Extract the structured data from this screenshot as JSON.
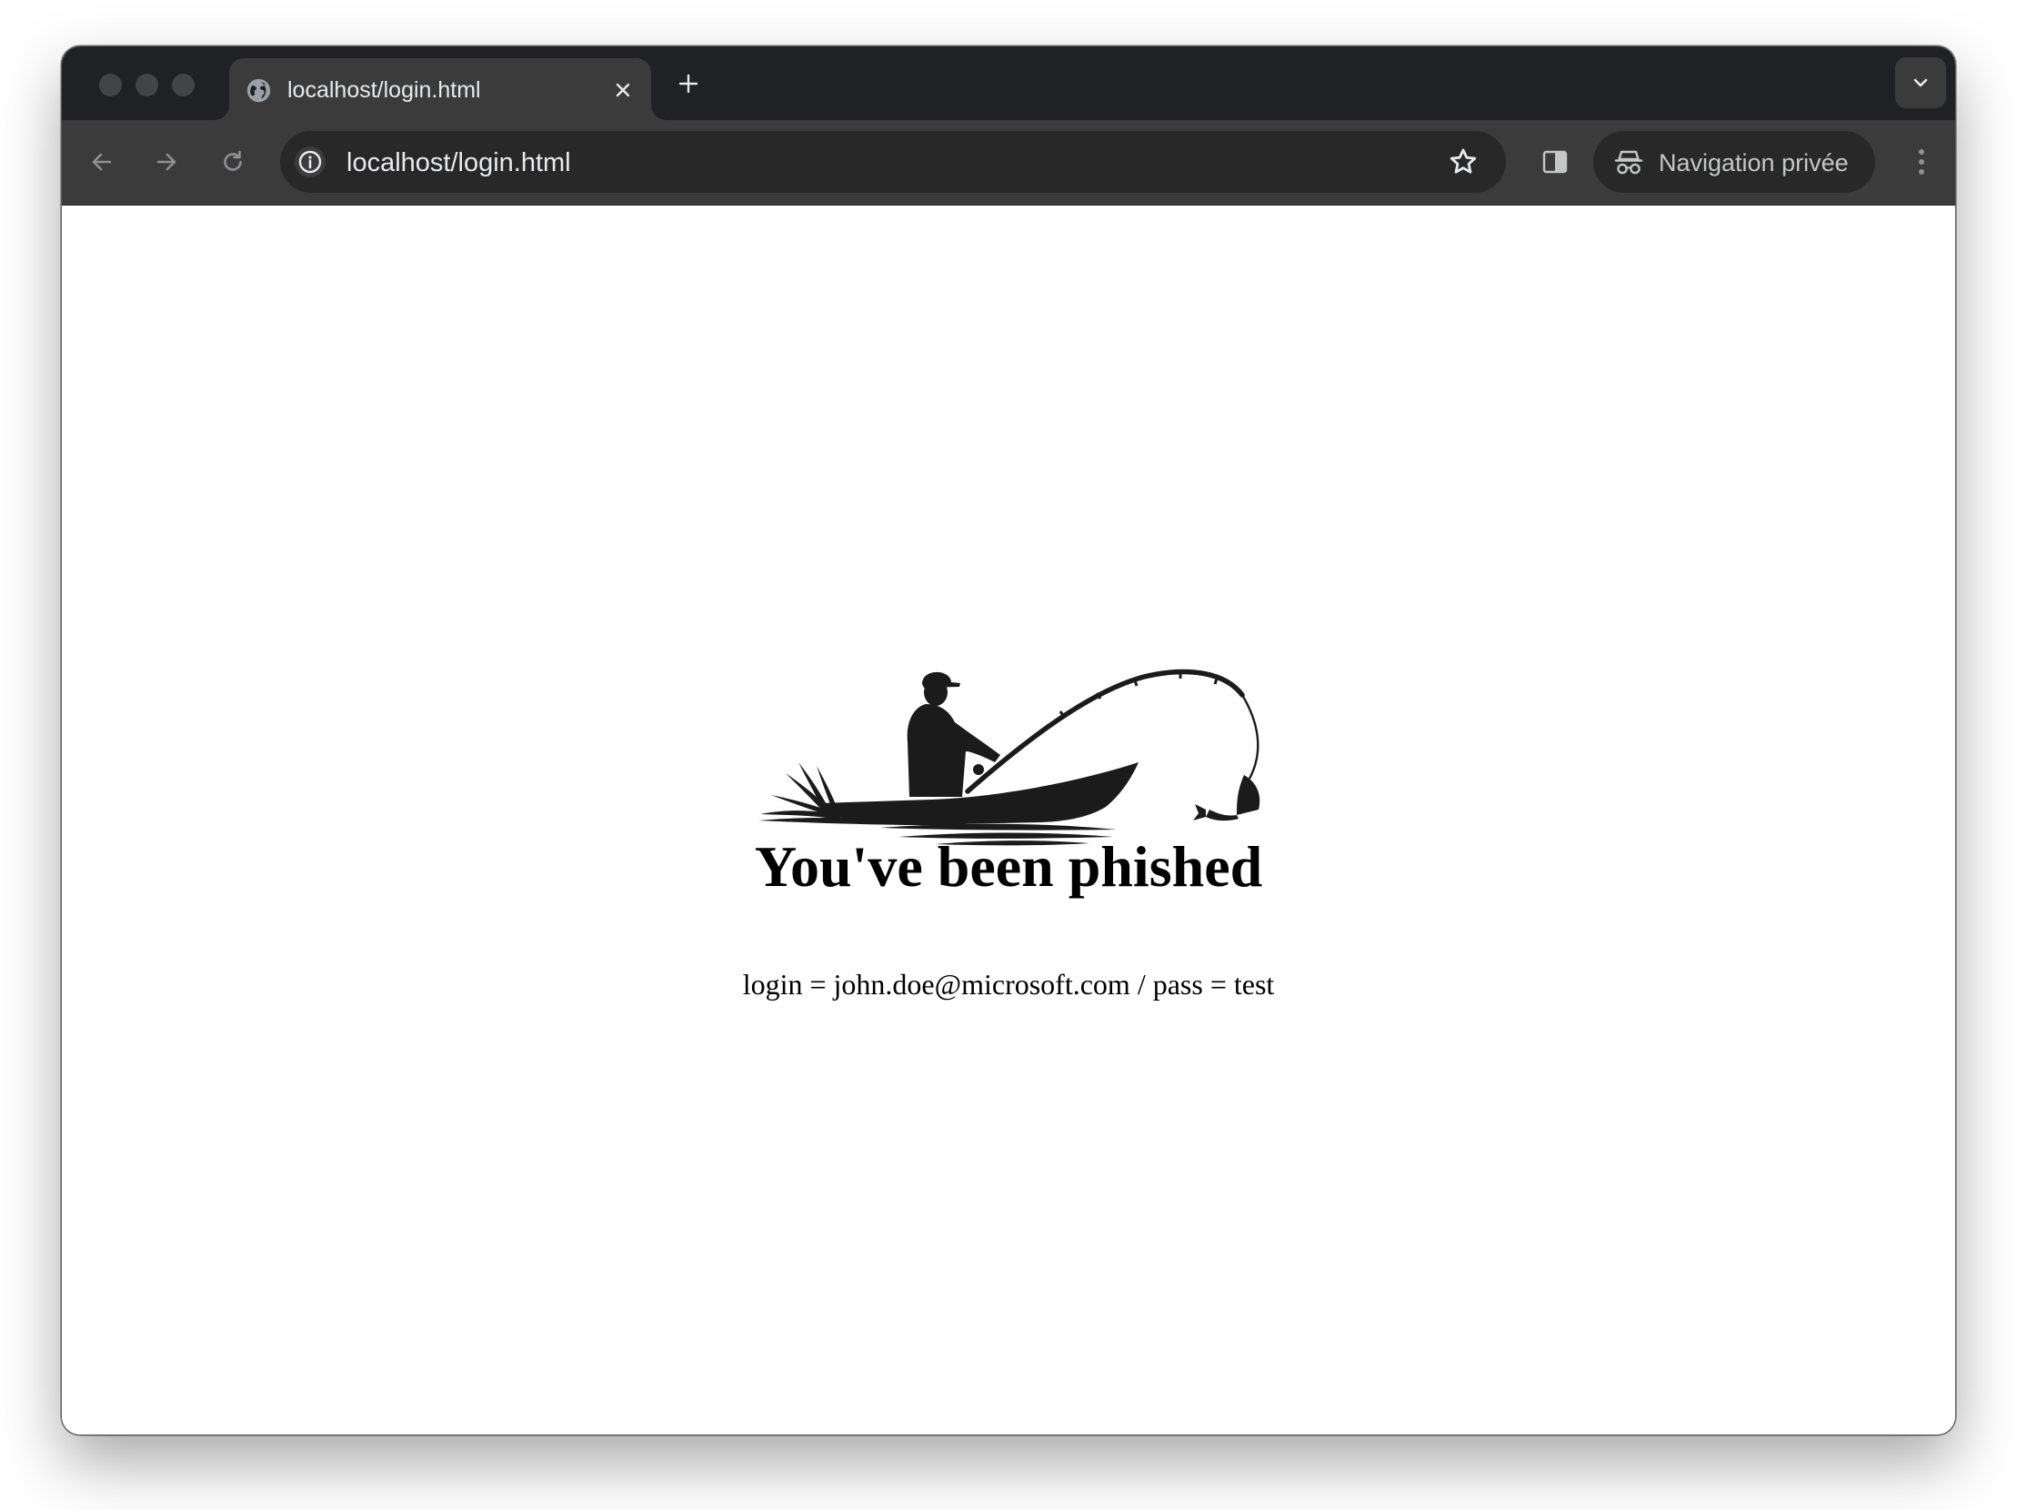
{
  "browser": {
    "tab": {
      "title": "localhost/login.html",
      "favicon": "globe-icon"
    },
    "toolbar": {
      "url": "localhost/login.html",
      "incognito_label": "Navigation privée"
    },
    "colors": {
      "tabstrip": "#202124",
      "toolbar": "#3b3b3b",
      "omnibox": "#282828",
      "text": "#e8eaed"
    }
  },
  "page": {
    "headline": "You've been phished",
    "credentials_text": "login = john.doe@microsoft.com / pass = test",
    "logo": "fisherman-in-boat-silhouette"
  }
}
